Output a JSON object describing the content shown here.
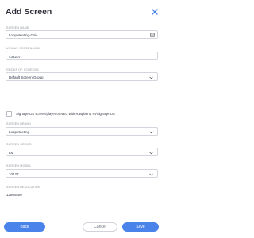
{
  "modal": {
    "title": "Add Screen"
  },
  "colors": {
    "accent": "#4a84ea",
    "label": "#8a8f98",
    "border": "#d2d6dc"
  },
  "icons": {
    "close": "close-icon",
    "keyboard": "keyboard-icon",
    "chevron": "chevron-down-icon"
  },
  "form": {
    "screen_name": {
      "label": "SCREEN NAME",
      "value": "LoopMeeting-Osic"
    },
    "unique_screen_link": {
      "label": "UNIQUE SCREEN LINK",
      "value": "433207"
    },
    "group_of_screens": {
      "label": "GROUP OF SCREENS",
      "value": "Default Screen Group"
    },
    "signage_checkbox": {
      "label": "Signage OS screen/player or NEC with Raspberry PI/Signage OS",
      "checked": false
    },
    "screen_brand": {
      "label": "SCREEN BRAND",
      "value": "LoopMeeting"
    },
    "screen_series": {
      "label": "SCREEN SERIES",
      "value": "LM"
    },
    "screen_model": {
      "label": "SCREEN MODEL",
      "value": "10127"
    },
    "screen_resolution": {
      "label": "SCREEN RESOLUTION",
      "value": "1280x800"
    }
  },
  "buttons": {
    "back": "Back",
    "cancel": "Cancel",
    "save": "Save"
  }
}
